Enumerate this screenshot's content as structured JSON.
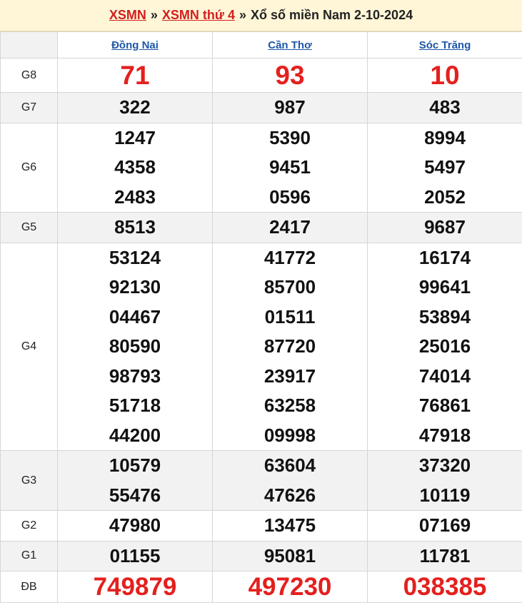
{
  "breadcrumb": {
    "link1": "XSMN",
    "link2": "XSMN thứ 4",
    "separator": "»",
    "title": "Xổ số miền Nam 2-10-2024"
  },
  "provinces": [
    "Đồng Nai",
    "Cần Thơ",
    "Sóc Trăng"
  ],
  "colors": {
    "red": "#e3201e",
    "blue_link": "#1e56a8",
    "breadcrumb_bg": "#fff6d8",
    "alt_row": "#f2f2f2"
  },
  "prizes": {
    "g8": {
      "label": "G8",
      "values": [
        [
          "71"
        ],
        [
          "93"
        ],
        [
          "10"
        ]
      ]
    },
    "g7": {
      "label": "G7",
      "values": [
        [
          "322"
        ],
        [
          "987"
        ],
        [
          "483"
        ]
      ]
    },
    "g6": {
      "label": "G6",
      "values": [
        [
          "1247",
          "4358",
          "2483"
        ],
        [
          "5390",
          "9451",
          "0596"
        ],
        [
          "8994",
          "5497",
          "2052"
        ]
      ]
    },
    "g5": {
      "label": "G5",
      "values": [
        [
          "8513"
        ],
        [
          "2417"
        ],
        [
          "9687"
        ]
      ]
    },
    "g4": {
      "label": "G4",
      "values": [
        [
          "53124",
          "92130",
          "04467",
          "80590",
          "98793",
          "51718",
          "44200"
        ],
        [
          "41772",
          "85700",
          "01511",
          "87720",
          "23917",
          "63258",
          "09998"
        ],
        [
          "16174",
          "99641",
          "53894",
          "25016",
          "74014",
          "76861",
          "47918"
        ]
      ]
    },
    "g3": {
      "label": "G3",
      "values": [
        [
          "10579",
          "55476"
        ],
        [
          "63604",
          "47626"
        ],
        [
          "37320",
          "10119"
        ]
      ]
    },
    "g2": {
      "label": "G2",
      "values": [
        [
          "47980"
        ],
        [
          "13475"
        ],
        [
          "07169"
        ]
      ]
    },
    "g1": {
      "label": "G1",
      "values": [
        [
          "01155"
        ],
        [
          "95081"
        ],
        [
          "11781"
        ]
      ]
    },
    "db": {
      "label": "ĐB",
      "values": [
        [
          "749879"
        ],
        [
          "497230"
        ],
        [
          "038385"
        ]
      ]
    }
  }
}
